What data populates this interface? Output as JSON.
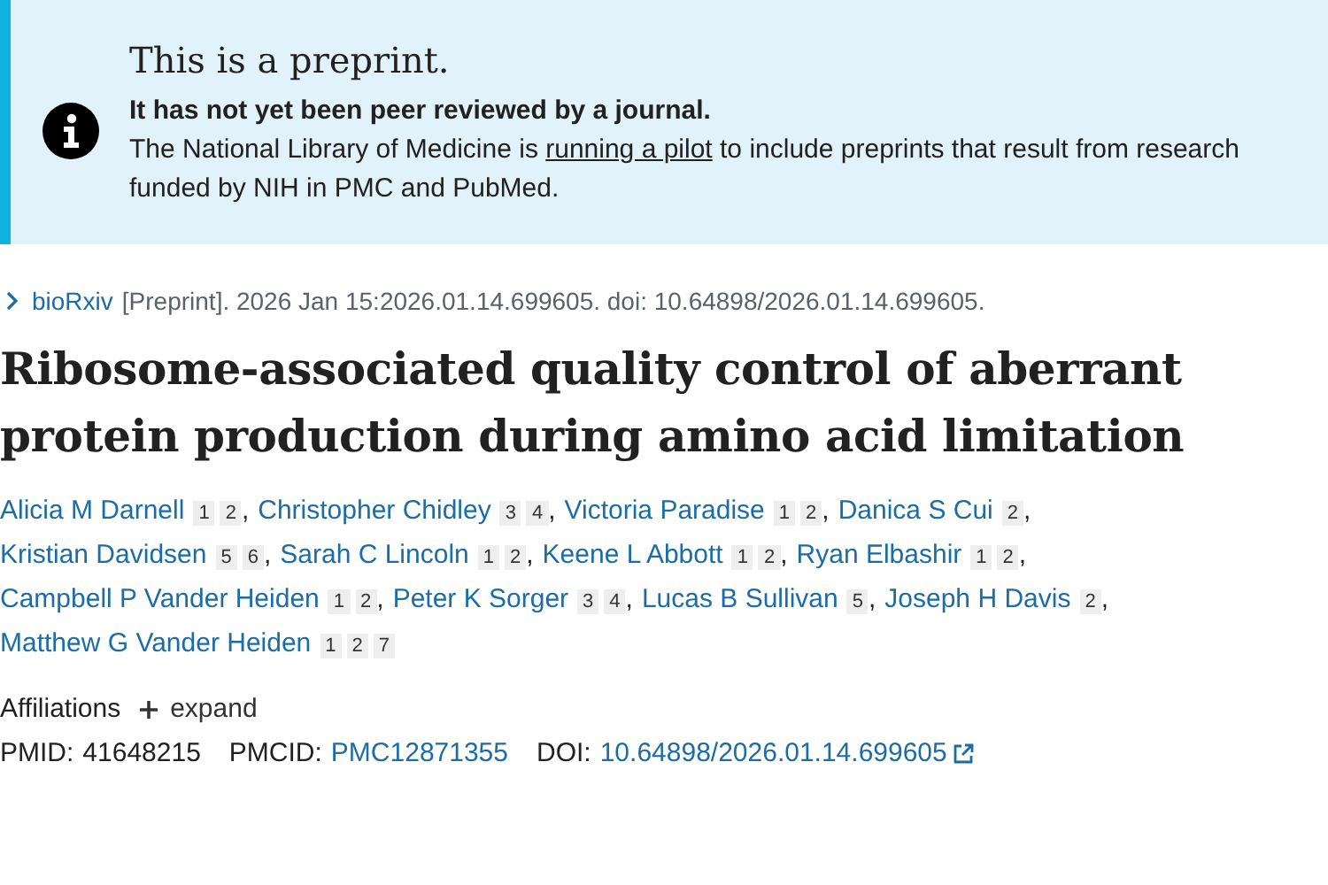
{
  "banner": {
    "title": "This is a preprint.",
    "subtitle": "It has not yet been peer reviewed by a journal.",
    "text_before": "The National Library of Medicine is",
    "link": "running a pilot",
    "text_after": "to include preprints that result from research funded by NIH in PMC and PubMed."
  },
  "citation": {
    "source": "bioRxiv",
    "details": "[Preprint]. 2026 Jan 15:2026.01.14.699605. doi: 10.64898/2026.01.14.699605."
  },
  "title": "Ribosome-associated quality control of aberrant protein production during amino acid limitation",
  "authors": [
    {
      "name": "Alicia M Darnell",
      "affiliations": [
        "1",
        "2"
      ],
      "separator": ","
    },
    {
      "name": "Christopher Chidley",
      "affiliations": [
        "3",
        "4"
      ],
      "separator": ","
    },
    {
      "name": "Victoria Paradise",
      "affiliations": [
        "1",
        "2"
      ],
      "separator": ","
    },
    {
      "name": "Danica S Cui",
      "affiliations": [
        "2"
      ],
      "separator": ","
    },
    {
      "name": "Kristian Davidsen",
      "affiliations": [
        "5",
        "6"
      ],
      "separator": ","
    },
    {
      "name": "Sarah C Lincoln",
      "affiliations": [
        "1",
        "2"
      ],
      "separator": ","
    },
    {
      "name": "Keene L Abbott",
      "affiliations": [
        "1",
        "2"
      ],
      "separator": ","
    },
    {
      "name": "Ryan Elbashir",
      "affiliations": [
        "1",
        "2"
      ],
      "separator": ","
    },
    {
      "name": "Campbell P Vander Heiden",
      "affiliations": [
        "1",
        "2"
      ],
      "separator": ","
    },
    {
      "name": "Peter K Sorger",
      "affiliations": [
        "3",
        "4"
      ],
      "separator": ","
    },
    {
      "name": "Lucas B Sullivan",
      "affiliations": [
        "5"
      ],
      "separator": ","
    },
    {
      "name": "Joseph H Davis",
      "affiliations": [
        "2"
      ],
      "separator": ","
    },
    {
      "name": "Matthew G Vander Heiden",
      "affiliations": [
        "1",
        "2",
        "7"
      ]
    }
  ],
  "affiliations": {
    "label": "Affiliations",
    "toggle": "expand",
    "expanded": false
  },
  "identifiers": [
    {
      "label": "PMID:",
      "value": "41648215",
      "kind": "text"
    },
    {
      "label": "PMCID:",
      "value": "PMC12871355",
      "kind": "link"
    },
    {
      "label": "DOI:",
      "value": "10.64898/2026.01.14.699605",
      "kind": "external"
    }
  ]
}
